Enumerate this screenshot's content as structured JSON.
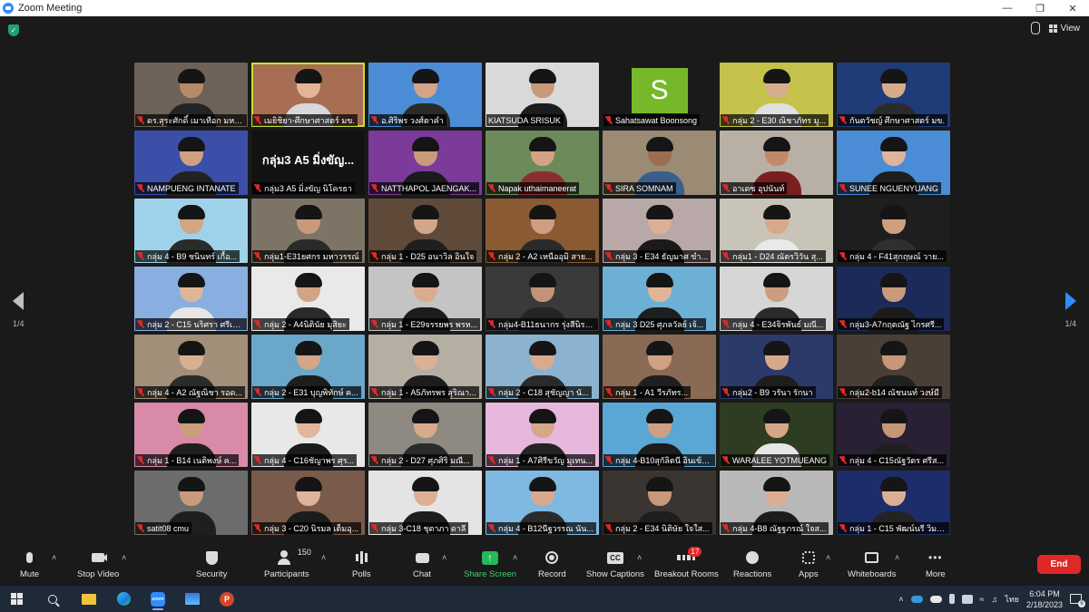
{
  "window": {
    "title": "Zoom Meeting",
    "controls": [
      "minimize",
      "maximize",
      "close"
    ]
  },
  "top_bar": {
    "security_icon": "shield-check-icon",
    "view_label": "View"
  },
  "pager": {
    "left_page": "1/4",
    "right_page": "1/4"
  },
  "participants": [
    {
      "name": "ดร.สุระศักดิ์ เมาเทือก มหาวิ...",
      "bg": "#6d6257",
      "shirt": "#242424",
      "skin": "#b88a6a",
      "muted": true
    },
    {
      "name": "เมยิชิยา-ศึกษาศาสตร์ มข.",
      "bg": "#a86e53",
      "shirt": "#d8d8d8",
      "skin": "#e3b598",
      "muted": true,
      "active": true
    },
    {
      "name": "อ.ศิริพร วงศ์ตาคำ",
      "bg": "#4a8dd6",
      "shirt": "#2a2a2a",
      "skin": "#d3a487",
      "muted": true
    },
    {
      "name": "KIATSUDA SRISUK",
      "bg": "#d9d9d9",
      "shirt": "#1d1d1d",
      "skin": "#c89a7b",
      "muted": false
    },
    {
      "name": "Sahatsawat Boonsong",
      "bg": "#1a1a1a",
      "letter": "S",
      "muted": true
    },
    {
      "name": "กลุ่ม 2 - E30 ณิชาภัทร มู...",
      "bg": "#c4c24b",
      "shirt": "#e0e0e0",
      "skin": "#d7ad8f",
      "muted": true
    },
    {
      "name": "กันตวัชญ์ ศึกษาศาสตร์ มข.",
      "bg": "#1f3b78",
      "shirt": "#2b2b2b",
      "skin": "#d6ab8c",
      "muted": true
    },
    {
      "name": "NAMPUENG INTANATE",
      "bg": "#3b4fa8",
      "shirt": "#222222",
      "skin": "#cf9f80",
      "muted": true
    },
    {
      "name": "กลุ่ม3 A5 มิ่งขัญ นิโครธา",
      "bg": "#121212",
      "banner": "กลุ่ม3 A5 มิ่งขัญ...",
      "muted": true
    },
    {
      "name": "NATTHAPOL JAENGAK...",
      "bg": "#7c3a9b",
      "shirt": "#1b1b1b",
      "skin": "#c99b7b",
      "muted": true
    },
    {
      "name": "Napak uthaimaneerat",
      "bg": "#6d8a5a",
      "shirt": "#8a2f2f",
      "skin": "#d2a385",
      "muted": true
    },
    {
      "name": "SIRA SOMNAM",
      "bg": "#9b8b74",
      "shirt": "#3a5f8a",
      "skin": "#9c6d4f",
      "muted": true
    },
    {
      "name": "อาเดซ อุปนันท์",
      "bg": "#b8b0a5",
      "shirt": "#7a1f1f",
      "skin": "#c08a6a",
      "muted": true
    },
    {
      "name": "SUNEE NGUENYUANG",
      "bg": "#4a8dd6",
      "shirt": "#1e1e1e",
      "skin": "#e0b39a",
      "muted": true
    },
    {
      "name": "กลุ่ม 4 - B9 ชนินทร์ เกื้อ...",
      "bg": "#9fd2ea",
      "shirt": "#2b2b2b",
      "skin": "#d3a586",
      "muted": true
    },
    {
      "name": "กลุ่ม1-E31ยศกร มหาวรรณ์",
      "bg": "#7d7466",
      "shirt": "#2a2a2a",
      "skin": "#c79a7b",
      "muted": true
    },
    {
      "name": "กลุ่ม 1 - D25 อนาวิล อินใจ",
      "bg": "#5f4a3a",
      "shirt": "#1f1f1f",
      "skin": "#d4a689",
      "muted": true
    },
    {
      "name": "กลุ่ม 2 - A2 เหนืออุมิ สาย...",
      "bg": "#8a5a33",
      "shirt": "#2a2a2a",
      "skin": "#cd9f80",
      "muted": true
    },
    {
      "name": "กลุ่ม 3 - E34 ธัญมาศ ขำ...",
      "bg": "#b9a8a8",
      "shirt": "#1a1a1a",
      "skin": "#dcb094",
      "muted": true
    },
    {
      "name": "กลุ่ม1 - D24 ณัตรวิวัน สุ...",
      "bg": "#c9c4b8",
      "shirt": "#e9e9e9",
      "skin": "#d7a98b",
      "muted": true
    },
    {
      "name": "กลุ่ม 4 - F41สุกฤษณ์ วาย...",
      "bg": "#1e1e1e",
      "shirt": "#2f2f2f",
      "skin": "#cf9f7f",
      "muted": true
    },
    {
      "name": "กลุ่ม 2 - C15 นริศรา ศรีเชิ...",
      "bg": "#89aee0",
      "shirt": "#e6e6e6",
      "skin": "#e0b49a",
      "muted": true
    },
    {
      "name": "กลุ่ม 2 - A4นิตินัย มุสิยะ",
      "bg": "#e9e9e9",
      "shirt": "#2a2a2a",
      "skin": "#d2a486",
      "muted": true
    },
    {
      "name": "กลุ่ม 1 - E29จรรยพร พรห...",
      "bg": "#c4c4c4",
      "shirt": "#1c1c1c",
      "skin": "#d9ac8f",
      "muted": true
    },
    {
      "name": "กลุ่ม4-B11ธนากร รุ่งสีนิรา...",
      "bg": "#3a3a3a",
      "shirt": "#242424",
      "skin": "#c2937a",
      "muted": true
    },
    {
      "name": "กลุ่ม 3 D25 ศุภลวัลย์ เจ้...",
      "bg": "#6db0d6",
      "shirt": "#1e1e1e",
      "skin": "#e1b59a",
      "muted": true
    },
    {
      "name": "กลุ่ม 4 - E34จิรพันธ์ มณี...",
      "bg": "#d6d6d6",
      "shirt": "#2b2b2b",
      "skin": "#cc9d7e",
      "muted": true
    },
    {
      "name": "กลุ่ม3-A7กฤตณัฐ ไกรศรี...",
      "bg": "#1c2a5a",
      "shirt": "#1b1b1b",
      "skin": "#c89b7d",
      "muted": true
    },
    {
      "name": "กลุ่ม 4 - A2 ณัฐณิชา รอด...",
      "bg": "#a18f7a",
      "shirt": "#2b2b2b",
      "skin": "#dcae90",
      "muted": true
    },
    {
      "name": "กลุ่ม 2 - E31 บุญพิทักษ์ ค...",
      "bg": "#6aa7c9",
      "shirt": "#1d1d1d",
      "skin": "#d4a587",
      "muted": true
    },
    {
      "name": "กลุ่ม 1 - A5ภัทรพร สุริณา...",
      "bg": "#b5aea3",
      "shirt": "#1c1c1c",
      "skin": "#dcb094",
      "muted": true
    },
    {
      "name": "กลุ่ม 2 - C18 สุชัญญา นั...",
      "bg": "#8bb3cf",
      "shirt": "#2a2a2a",
      "skin": "#d9ab8e",
      "muted": true
    },
    {
      "name": "กลุ่ม 1 - A1 วีรภัทร...",
      "bg": "#8a6a55",
      "shirt": "#1f1f1f",
      "skin": "#d0a083",
      "muted": true
    },
    {
      "name": "กลุ่ม2 - B9 วรันา รักนา",
      "bg": "#2c3a6a",
      "shirt": "#1e1e1e",
      "skin": "#d7a98c",
      "muted": true
    },
    {
      "name": "กลุ่ม2-b14 ณัชนนท์ วงษ์มี",
      "bg": "#4a3f37",
      "shirt": "#202020",
      "skin": "#c69779",
      "muted": true
    },
    {
      "name": "กลุ่ม 1 - B14 เนติพงษ์ ค...",
      "bg": "#d88aa8",
      "shirt": "#1f1f1f",
      "skin": "#cc9c7d",
      "muted": true
    },
    {
      "name": "กลุ่ม 4 - C16ชัญาพร ศุร...",
      "bg": "#e8e8e8",
      "shirt": "#1b1b1b",
      "skin": "#e2b69b",
      "muted": true
    },
    {
      "name": "กลุ่ม 2 - D27 ศุภศิริ มณี...",
      "bg": "#8e8a82",
      "shirt": "#2b2b2b",
      "skin": "#d8aa8c",
      "muted": true
    },
    {
      "name": "กลุ่ม 1 - A7ศิรีขวัญ มุเทน...",
      "bg": "#e7b7dc",
      "shirt": "#242424",
      "skin": "#d6a789",
      "muted": true
    },
    {
      "name": "กลุ่ม 4-B10สุกัลิตนี อินเข้า...",
      "bg": "#5aa7d6",
      "shirt": "#1c1c1c",
      "skin": "#cf9f81",
      "muted": true
    },
    {
      "name": "WARALEE YOTMUEANG",
      "bg": "#2e3d22",
      "shirt": "#e6e6e6",
      "skin": "#d4a687",
      "muted": true
    },
    {
      "name": "กลุ่ม 4 - C15ณัฐวัตร ศรีส...",
      "bg": "#2a2035",
      "shirt": "#1f1f1f",
      "skin": "#c69779",
      "muted": true
    },
    {
      "name": "satit08 cmu",
      "bg": "#6c6c6c",
      "shirt": "#1f1f1f",
      "skin": "#c99b7c",
      "muted": true
    },
    {
      "name": "กลุ่ม 3 - C20 นิรมล เต็มอุ...",
      "bg": "#7a5a4a",
      "shirt": "#1c1c1c",
      "skin": "#e0b49a",
      "muted": true
    },
    {
      "name": "กลุ่ม 3-C18 ชุตาภา ดาลี",
      "bg": "#e4e4e4",
      "shirt": "#1e1e1e",
      "skin": "#dcb094",
      "muted": true
    },
    {
      "name": "กลุ่ม 4 - B12นีฐวรรณ นัน...",
      "bg": "#7fb8e0",
      "shirt": "#2b2b2b",
      "skin": "#d8aa8d",
      "muted": true
    },
    {
      "name": "กลุ่ม 2 - E34 นิติษัย ใจใส...",
      "bg": "#3a3530",
      "shirt": "#1e1e1e",
      "skin": "#c79879",
      "muted": true
    },
    {
      "name": "กลุ่ม 4-B8 ณัฐฐภรณ์ ใจส...",
      "bg": "#b8b8b8",
      "shirt": "#1c1c1c",
      "skin": "#dcae91",
      "muted": true
    },
    {
      "name": "กลุ่ม 1 - C15 พัฒน์นรี วิมล...",
      "bg": "#1d2d6a",
      "shirt": "#232323",
      "skin": "#dcaf93",
      "muted": true
    }
  ],
  "toolbar": {
    "mute": "Mute",
    "stop_video": "Stop Video",
    "security": "Security",
    "participants": "Participants",
    "participants_count": "150",
    "polls": "Polls",
    "chat": "Chat",
    "share_screen": "Share Screen",
    "record": "Record",
    "show_captions": "Show Captions",
    "breakout_rooms": "Breakout Rooms",
    "breakout_badge": "17",
    "reactions": "Reactions",
    "apps": "Apps",
    "whiteboards": "Whiteboards",
    "more": "More",
    "end": "End"
  },
  "taskbar": {
    "apps": [
      "windows-start",
      "search",
      "file-explorer",
      "edge",
      "zoom",
      "photos",
      "powerpoint"
    ],
    "language": "ไทย",
    "time": "6:04 PM",
    "date": "2/18/2023",
    "notification_count": "6"
  },
  "colors": {
    "accent_blue": "#2d8cff",
    "share_green": "#26b85a",
    "end_red": "#e02828",
    "active_speaker": "#c7de3a"
  }
}
